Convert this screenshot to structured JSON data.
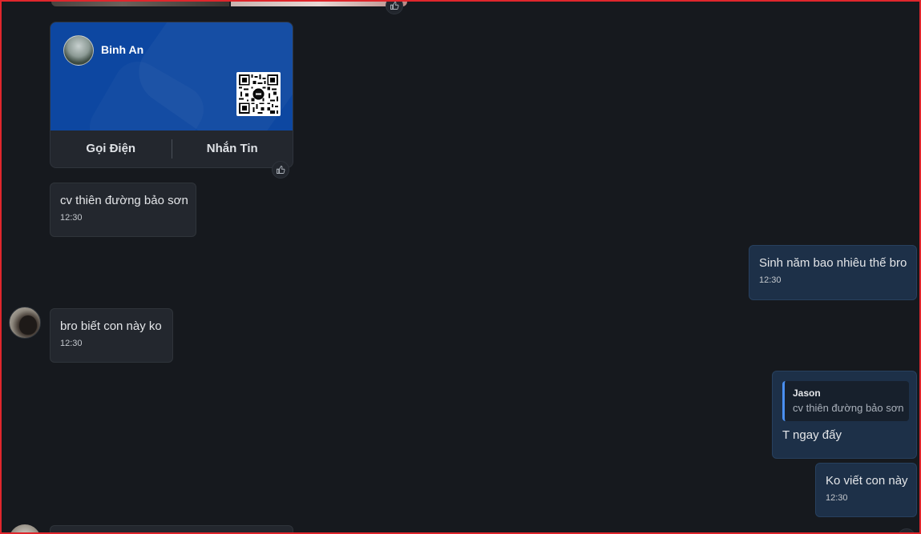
{
  "contact_card": {
    "name": "Binh An",
    "actions": [
      "Gọi Điện",
      "Nhắn Tin"
    ]
  },
  "messages": [
    {
      "direction": "incoming",
      "text": "cv thiên đường bảo sơn",
      "time": "12:30"
    },
    {
      "direction": "outgoing",
      "text": "Sinh năm bao nhiêu thế bro",
      "time": "12:30"
    },
    {
      "direction": "incoming",
      "text": "bro biết con này ko",
      "time": "12:30"
    },
    {
      "direction": "outgoing",
      "quote": {
        "author": "Jason",
        "text": "cv thiên đường bảo sơn"
      },
      "text": "T ngay đấy"
    },
    {
      "direction": "outgoing",
      "text": "Ko viết con này",
      "time": "12:30"
    }
  ],
  "icons": {
    "reaction": "thumbs-up-icon",
    "qr": "qr-code-icon"
  },
  "colors": {
    "background": "#16191e",
    "card_blue": "#0d47a1",
    "incoming_bubble": "#23272e",
    "outgoing_bubble": "#1d3048",
    "quote_accent": "#4a8ff0",
    "frame": "#e0262c"
  }
}
